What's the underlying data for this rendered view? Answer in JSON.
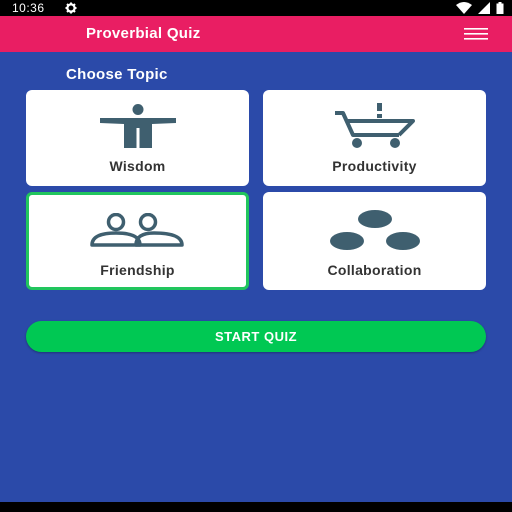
{
  "status_bar": {
    "time": "10:36",
    "icons": [
      "gear-icon",
      "wifi-icon",
      "signal-icon",
      "battery-icon"
    ]
  },
  "app_bar": {
    "title": "Proverbial Quiz",
    "menu_icon": "hamburger-menu-icon"
  },
  "section_title": "Choose Topic",
  "topics": [
    {
      "label": "Wisdom",
      "icon": "person-icon",
      "selected": false
    },
    {
      "label": "Productivity",
      "icon": "cart-icon",
      "selected": false
    },
    {
      "label": "Friendship",
      "icon": "people-icon",
      "selected": true
    },
    {
      "label": "Collaboration",
      "icon": "three-circles-icon",
      "selected": false
    }
  ],
  "start_button": {
    "label": "START QUIZ"
  },
  "colors": {
    "background": "#2b4aa9",
    "app_bar": "#e91e63",
    "accent_green": "#00c853",
    "selected_border": "#21c55d",
    "icon": "#3f5f6f"
  }
}
